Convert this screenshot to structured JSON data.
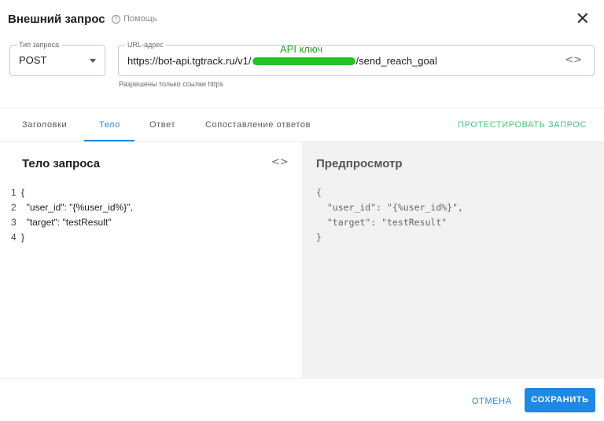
{
  "dialog": {
    "title": "Внешний запрос",
    "help_label": "Помощь",
    "help_icon": "question-circle-icon",
    "close_icon": "close-icon",
    "close_glyph": "✕"
  },
  "request_type": {
    "label": "Тип запроса",
    "value": "POST"
  },
  "url": {
    "label": "URL-адрес",
    "prefix": "https://bot-api.tgtrack.ru/v1/",
    "suffix": "/send_reach_goal",
    "annotation": "API ключ",
    "annotation_color": "#2aa52a",
    "redaction_color": "#22c322",
    "code_glyph": "<>",
    "hint": "Разрешены только ссылки https"
  },
  "tabs": [
    {
      "label": "Заголовки",
      "active": false
    },
    {
      "label": "Тело",
      "active": true
    },
    {
      "label": "Ответ",
      "active": false
    },
    {
      "label": "Сопоставление ответов",
      "active": false
    }
  ],
  "test_button": "ПРОТЕСТИРОВАТЬ ЗАПРОС",
  "editor": {
    "title": "Тело запроса",
    "code_glyph": "<>",
    "lines": [
      {
        "num": "1",
        "text": "{"
      },
      {
        "num": "2",
        "text": "  \"user_id\": \"{%user_id%}\","
      },
      {
        "num": "3",
        "text": "  \"target\": \"testResult\""
      },
      {
        "num": "4",
        "text": "}"
      }
    ]
  },
  "preview": {
    "title": "Предпросмотр",
    "lines": [
      "{",
      "  \"user_id\": \"{%user_id%}\",",
      "  \"target\": \"testResult\"",
      "}"
    ]
  },
  "footer": {
    "cancel": "ОТМЕНА",
    "save": "СОХРАНИТЬ"
  },
  "colors": {
    "primary": "#1e88e5",
    "accent_green": "#43c57a"
  }
}
